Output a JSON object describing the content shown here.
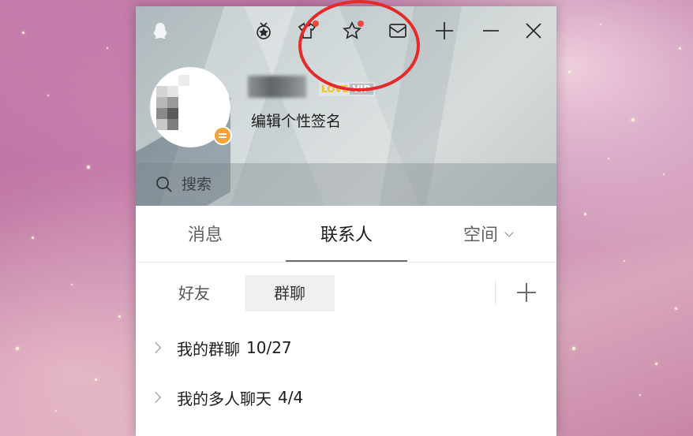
{
  "window": {
    "titlebar": {
      "buttons": [
        {
          "name": "medal-icon"
        },
        {
          "name": "shirt-icon"
        },
        {
          "name": "star-icon"
        },
        {
          "name": "mail-icon"
        },
        {
          "name": "plus-icon"
        },
        {
          "name": "minimize-icon"
        },
        {
          "name": "close-icon"
        }
      ]
    },
    "profile": {
      "vip_badge": "LOVE",
      "vip_suffix": "VIP",
      "signature": "编辑个性签名"
    },
    "search": {
      "placeholder": "搜索"
    },
    "tabs": [
      {
        "label": "消息",
        "active": false
      },
      {
        "label": "联系人",
        "active": true
      },
      {
        "label": "空间",
        "active": false
      }
    ],
    "sub_tabs": [
      {
        "label": "好友",
        "active": false
      },
      {
        "label": "群聊",
        "active": true
      }
    ],
    "groups": [
      {
        "label": "我的群聊",
        "count": "10/27"
      },
      {
        "label": "我的多人聊天",
        "count": "4/4"
      }
    ]
  },
  "colors": {
    "notification_dot": "#e8483e",
    "status_badge": "#f4a33a",
    "annotation_circle": "#e42a2a"
  }
}
